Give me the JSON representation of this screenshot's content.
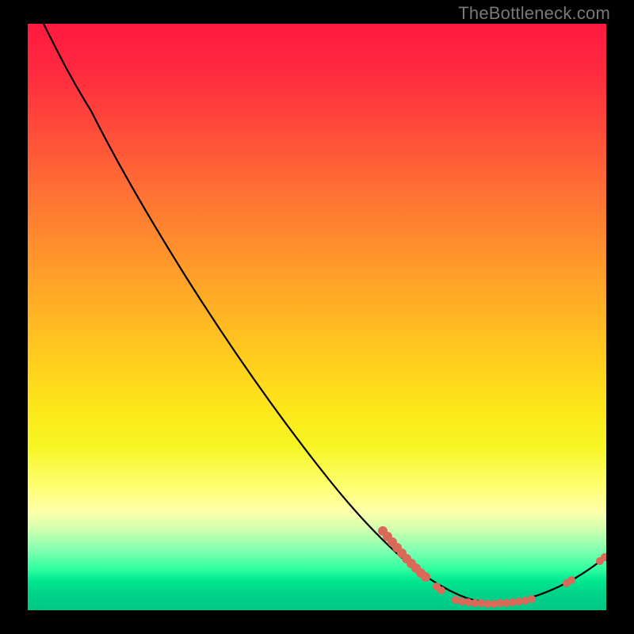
{
  "watermark": "TheBottleneck.com",
  "chart_data": {
    "type": "line",
    "title": "",
    "xlabel": "",
    "ylabel": "",
    "xlim": [
      0,
      100
    ],
    "ylim": [
      0,
      100
    ],
    "background_gradient": {
      "direction": "vertical",
      "stops": [
        {
          "pos": 0,
          "color": "#ff1a3f"
        },
        {
          "pos": 50,
          "color": "#ffcf1d"
        },
        {
          "pos": 80,
          "color": "#ffff72"
        },
        {
          "pos": 100,
          "color": "#00c786"
        }
      ]
    },
    "series": [
      {
        "name": "bottleneck-curve",
        "color": "#000000",
        "x": [
          3,
          11,
          27,
          41,
          52,
          66,
          76,
          82,
          88,
          94,
          100
        ],
        "y": [
          100,
          85,
          57,
          35,
          22,
          7,
          2,
          1,
          2,
          5,
          9
        ]
      }
    ],
    "scatter": {
      "name": "highlighted-points",
      "color": "#d96a5a",
      "x": [
        61,
        62,
        63,
        64,
        65,
        66,
        67,
        68,
        69,
        70,
        71,
        72,
        74,
        75,
        76,
        77,
        78,
        79,
        80,
        81,
        82,
        83,
        84,
        85,
        86,
        87,
        93,
        94,
        99,
        100
      ],
      "y": [
        13,
        12,
        12,
        11,
        10,
        9,
        8,
        7,
        6,
        6,
        4,
        3,
        2,
        1,
        1,
        1,
        1,
        1,
        1,
        1,
        1,
        1,
        1,
        2,
        2,
        2,
        5,
        5,
        8,
        9
      ]
    }
  }
}
